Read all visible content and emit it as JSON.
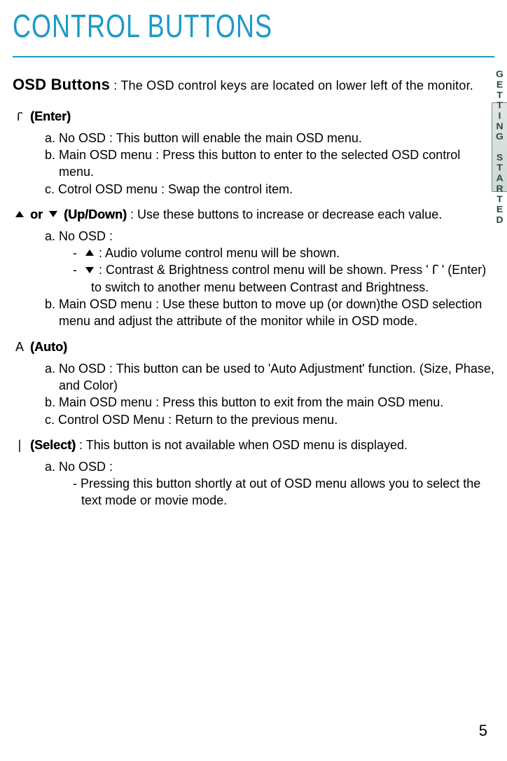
{
  "title": "CONTROL BUTTONS",
  "side_tab": "GETTING STARTED",
  "intro_bold": "OSD Buttons",
  "intro_text": " : The OSD control keys are located on lower left of the monitor.",
  "sections": {
    "enter": {
      "label": "(Enter)",
      "a": "a. No OSD : This button will enable the main OSD menu.",
      "b": "b. Main OSD menu : Press this button to enter to the selected OSD control menu.",
      "c": "c.  Cotrol OSD menu : Swap the control item."
    },
    "updown": {
      "or": "or",
      "label": "(Up/Down)",
      "desc": " : Use these buttons to increase or decrease each value.",
      "a": "a. No OSD :",
      "a_up": " : Audio volume control menu will be shown.",
      "a_down": " : Contrast & Brightness control menu will be shown. Press ' ꓩ ' (Enter) to switch to another menu between Contrast and Brightness.",
      "b": "b. Main OSD menu : Use these button to move up (or down)the OSD selection menu and adjust the attribute of the monitor while in OSD mode."
    },
    "auto": {
      "symbol": "A",
      "label": "(Auto)",
      "a": "a. No OSD : This button can be used to 'Auto Adjustment' function. (Size, Phase, and Color)",
      "b": "b. Main OSD menu : Press this button to exit from the main OSD menu.",
      "c": "c. Control OSD Menu : Return to the previous menu."
    },
    "select": {
      "symbol": "|",
      "label": "(Select)",
      "desc": " : This button is not available when OSD menu is displayed.",
      "a": "a. No OSD :",
      "a_sub": "- Pressing this button shortly at out of OSD menu allows you to select the text mode or movie mode."
    }
  },
  "page_number": "5"
}
